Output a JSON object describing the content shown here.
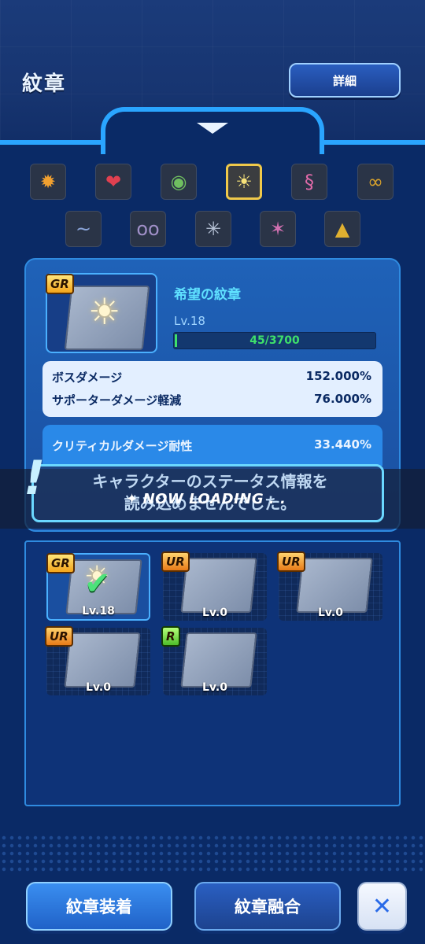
{
  "header": {
    "title": "紋章",
    "detail_label": "詳細"
  },
  "crest_tabs": [
    {
      "name": "courage-crest-icon",
      "glyph": "✹",
      "color": "#f0a030"
    },
    {
      "name": "love-crest-icon",
      "glyph": "❤",
      "color": "#e04050"
    },
    {
      "name": "sincerity-crest-icon",
      "glyph": "◉",
      "color": "#6fbf60"
    },
    {
      "name": "hope-crest-icon",
      "glyph": "☀",
      "color": "#f7e27a"
    },
    {
      "name": "light-crest-icon",
      "glyph": "§",
      "color": "#e06aa8"
    },
    {
      "name": "knowledge-crest-icon",
      "glyph": "∞",
      "color": "#d8a22c"
    },
    {
      "name": "friendship-crest-icon",
      "glyph": "~",
      "color": "#8aa4d8"
    },
    {
      "name": "reliability-crest-icon",
      "glyph": "oo",
      "color": "#a090c8"
    },
    {
      "name": "kindness-crest-icon",
      "glyph": "✳",
      "color": "#b8c4d8"
    },
    {
      "name": "miracles-crest-icon",
      "glyph": "✶",
      "color": "#d070b0"
    },
    {
      "name": "destiny-crest-icon",
      "glyph": "▲",
      "color": "#e0b030"
    }
  ],
  "selected_crest": {
    "rank": "GR",
    "name": "希望の紋章",
    "level": "Lv.18",
    "xp": "45/3700",
    "xp_fraction": 0.012
  },
  "stats": [
    {
      "label": "ボスダメージ",
      "value": "152.000%"
    },
    {
      "label": "サポーターダメージ軽減",
      "value": "76.000%"
    }
  ],
  "crit_stat": {
    "label": "クリティカルダメージ耐性",
    "value": "33.440%"
  },
  "overlay": {
    "message_line1": "キャラクターのステータス情報を",
    "message_line2": "読み込めませんでした。",
    "loading": "NOW LOADING . ."
  },
  "inventory": [
    {
      "rank": "GR",
      "level": "Lv.18",
      "selected": true
    },
    {
      "rank": "UR",
      "level": "Lv.0",
      "selected": false
    },
    {
      "rank": "UR",
      "level": "Lv.0",
      "selected": false
    },
    {
      "rank": "UR",
      "level": "Lv.0",
      "selected": false
    },
    {
      "rank": "R",
      "level": "Lv.0",
      "selected": false
    }
  ],
  "buttons": {
    "equip": "紋章装着",
    "fuse": "紋章融合",
    "close": "✕"
  }
}
